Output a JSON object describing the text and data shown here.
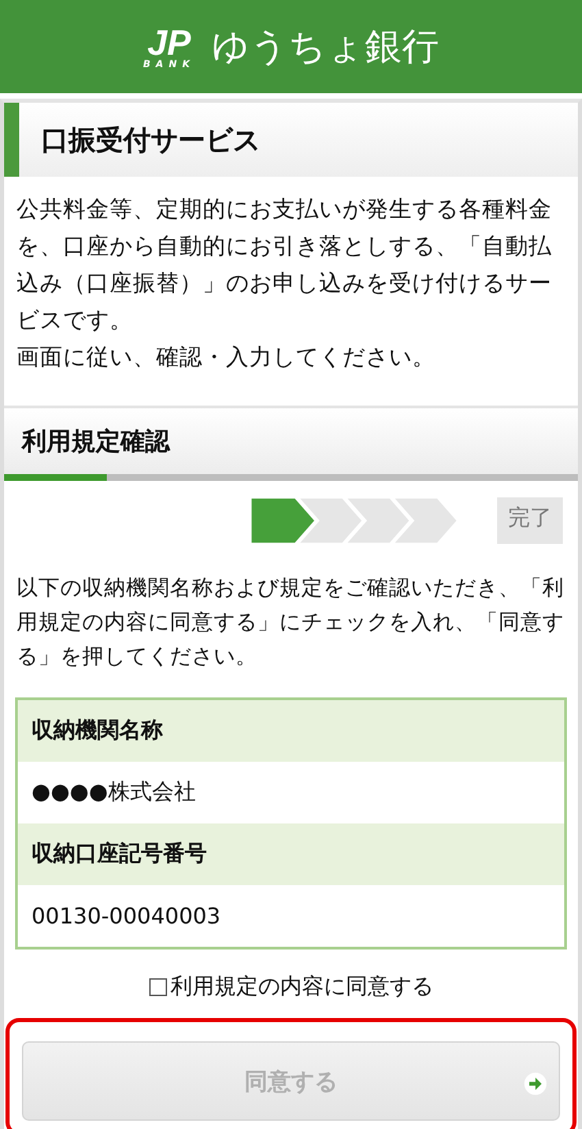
{
  "header": {
    "logo_mark": "JP",
    "logo_sub": "BANK",
    "title": "ゆうちょ銀行"
  },
  "service": {
    "title": "口振受付サービス",
    "paragraphs": [
      "公共料金等、定期的にお支払いが発生する各種料金を、口座から自動的にお引き落としする、「自動払込み（口座振替）」のお申し込みを受け付けるサービスです。",
      "画面に従い、確認・入力してください。"
    ]
  },
  "step_section": {
    "title": "利用規定確認",
    "progress": {
      "level": 0.18
    },
    "steps": [
      {
        "selected": true
      },
      {
        "selected": false
      },
      {
        "selected": false
      },
      {
        "selected": false
      }
    ],
    "final_step": "完了"
  },
  "instruction": "以下の収納機関名称および規定をご確認いただき、「利用規定の内容に同意する」にチェックを入れ、「同意する」を押してください。",
  "info_table": [
    {
      "kind": "label",
      "text": "収納機関名称"
    },
    {
      "kind": "value",
      "text": "●●●●株式会社"
    },
    {
      "kind": "label",
      "text": "収納口座記号番号"
    },
    {
      "kind": "value",
      "text": "00130-00040003"
    }
  ],
  "agree_checkbox": {
    "label": "利用規定の内容に同意する",
    "checked": false
  },
  "agree_button": {
    "label": "同意する",
    "disabled": true
  }
}
